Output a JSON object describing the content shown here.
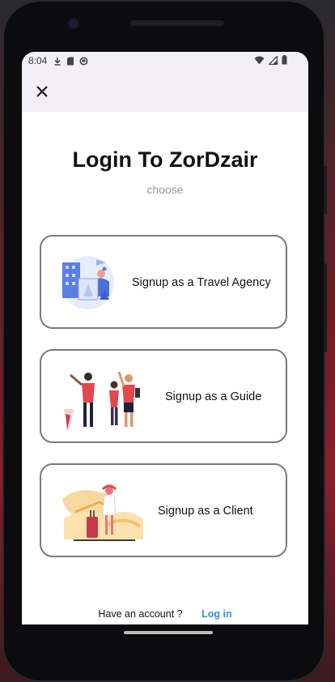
{
  "status_bar": {
    "time": "8:04",
    "left_icons": [
      "download-icon",
      "sd-card-icon",
      "circle-app-icon"
    ],
    "right_icons": [
      "wifi-icon",
      "signal-icon",
      "battery-icon"
    ]
  },
  "app_bar": {
    "close_icon": "close-icon"
  },
  "page": {
    "title": "Login To ZorDzair",
    "subtitle": "choose"
  },
  "options": [
    {
      "label": "Signup as a Travel Agency",
      "illustration": "travel-agency-illustration"
    },
    {
      "label": "Signup as a Guide",
      "illustration": "guide-illustration"
    },
    {
      "label": "Signup as a Client",
      "illustration": "client-illustration"
    }
  ],
  "footer": {
    "prompt": "Have an account  ?",
    "login_link": "Log in"
  },
  "colors": {
    "accent": "#2f8fdc",
    "card_border": "#7a7a7a",
    "appbar_bg": "#f2eff6",
    "subtitle": "#9a9a9a"
  }
}
